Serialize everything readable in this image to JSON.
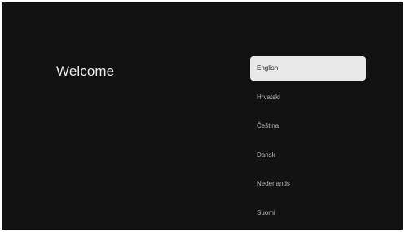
{
  "screen": {
    "title": "Welcome"
  },
  "languages": [
    {
      "label": "English",
      "selected": true
    },
    {
      "label": "Hrvatski",
      "selected": false
    },
    {
      "label": "Čeština",
      "selected": false
    },
    {
      "label": "Dansk",
      "selected": false
    },
    {
      "label": "Nederlands",
      "selected": false
    },
    {
      "label": "Suomi",
      "selected": false
    }
  ]
}
